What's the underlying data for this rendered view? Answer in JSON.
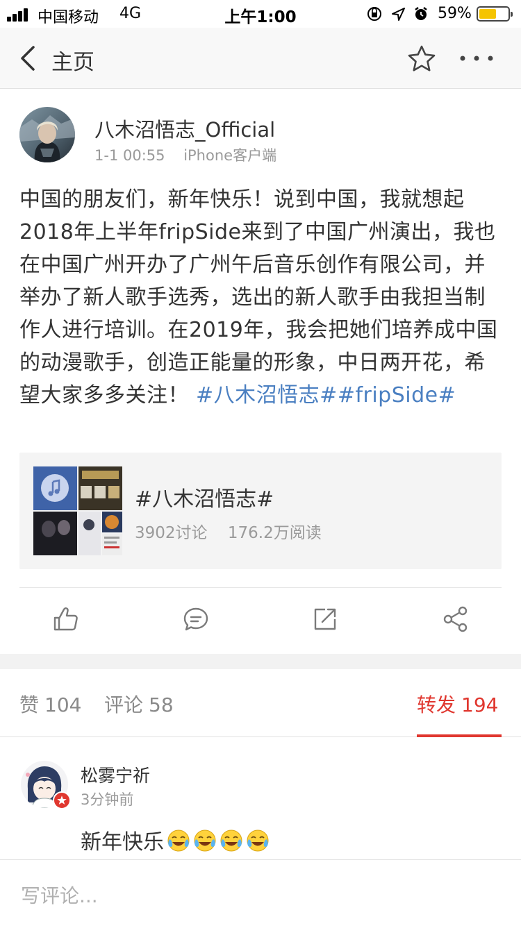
{
  "status_bar": {
    "carrier": "中国移动",
    "network": "4G",
    "time": "上午1:00",
    "battery_percent": "59%",
    "battery_level": 0.59,
    "battery_color": "#f5c400"
  },
  "nav": {
    "back_icon": "chevron-left-icon",
    "title": "主页",
    "star_icon": "star-icon",
    "more_icon": "more-icon"
  },
  "post": {
    "author": "八木沼悟志_Official",
    "date": "1-1 00:55",
    "source": "iPhone客户端",
    "text": "中国的朋友们，新年快乐！说到中国，我就想起2018年上半年fripSide来到了中国广州演出，我也在中国广州开办了广州午后音乐创作有限公司，并举办了新人歌手选秀，选出的新人歌手由我担当制作人进行培训。在2019年，我会把她们培养成中国的动漫歌手，创造正能量的形象，中日两开花，希望大家多多关注！",
    "tags": "#八木沼悟志##fripSide#",
    "tag_color": "#4a7fc1",
    "topic": {
      "title": "#八木沼悟志#",
      "discussions": "3902讨论",
      "reads": "176.2万阅读"
    },
    "actions": [
      {
        "icon": "thumbs-up-icon"
      },
      {
        "icon": "comment-icon"
      },
      {
        "icon": "repost-icon"
      },
      {
        "icon": "share-icon"
      }
    ]
  },
  "tabs": {
    "likes_label": "赞",
    "likes_count": "104",
    "comments_label": "评论",
    "comments_count": "58",
    "reposts_label": "转发",
    "reposts_count": "194",
    "active_color": "#e0372f"
  },
  "comment": {
    "name": "松雾宁祈",
    "time": "3分钟前",
    "text": "新年快乐",
    "emoji_icon": "laughing-crying-emoji-icon"
  },
  "input": {
    "placeholder": "写评论..."
  }
}
